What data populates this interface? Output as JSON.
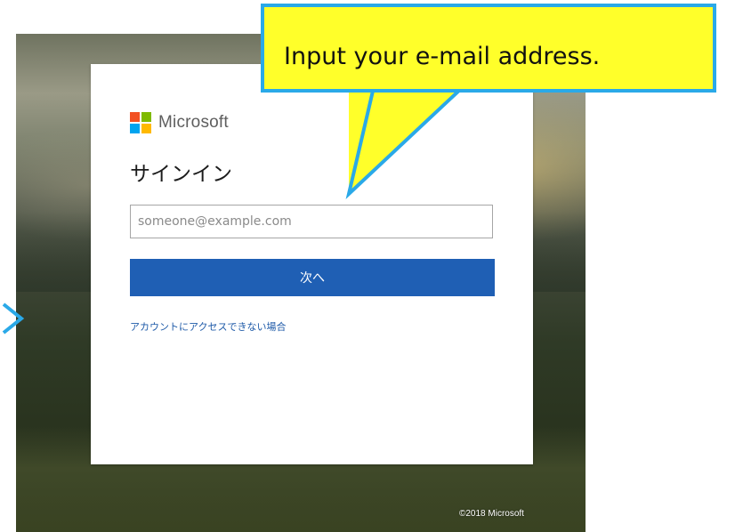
{
  "callout": {
    "text": "Input your e-mail address."
  },
  "brand": {
    "name": "Microsoft"
  },
  "signin": {
    "title": "サインイン",
    "email_placeholder": "someone@example.com",
    "email_value": "",
    "next_label": "次へ",
    "help_link": "アカウントにアクセスできない場合"
  },
  "footer": {
    "copyright": "©2018 Microsoft"
  },
  "colors": {
    "callout_fill": "#ffff2a",
    "callout_border": "#2aa9e8",
    "button": "#1f5fb4",
    "link": "#1e5aa8",
    "logo_red": "#f25022",
    "logo_green": "#7fba00",
    "logo_blue": "#00a4ef",
    "logo_yellow": "#ffb900"
  }
}
